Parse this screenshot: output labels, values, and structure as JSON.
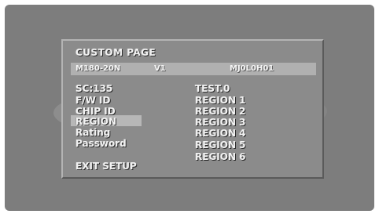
{
  "title": "CUSTOM PAGE",
  "info_bar": {
    "left": "M180-20N",
    "middle": "V1",
    "right": "MJ0L0H01"
  },
  "menu": {
    "header": "SC:135",
    "items": [
      "F/W ID",
      "CHIP ID",
      "REGION",
      "Rating",
      "Password"
    ],
    "selected_index": 2
  },
  "values": {
    "header": "TEST.0",
    "regions": [
      "REGION 1",
      "REGION 2",
      "REGION 3",
      "REGION 4",
      "REGION 5",
      "REGION 6"
    ]
  },
  "exit_label": "EXIT SETUP",
  "colors": {
    "screen_bg": "#7d7d7d",
    "panel_bg": "#8b8b8b",
    "highlight": "#b7b7b7",
    "text": "#f2f2f2"
  }
}
